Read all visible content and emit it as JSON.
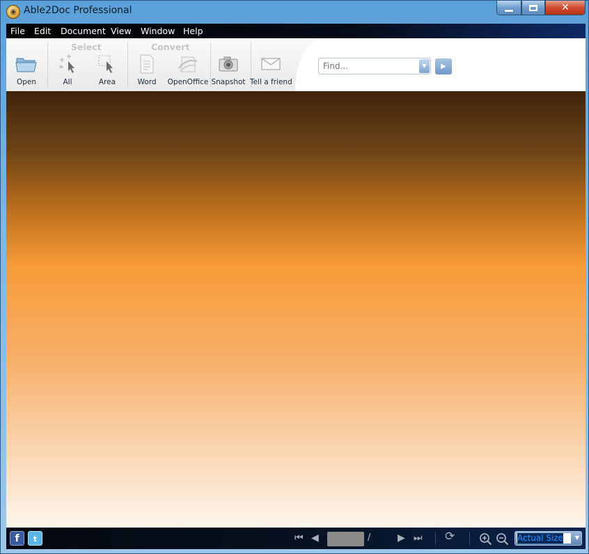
{
  "window": {
    "title": "Able2Doc Professional",
    "icon": "able2doc-logo-icon"
  },
  "menu": [
    "File",
    "Edit",
    "Document",
    "View",
    "Window",
    "Help"
  ],
  "toolbar": {
    "open_label": "Open",
    "select_group": "Select",
    "select_all_label": "All",
    "select_area_label": "Area",
    "convert_group": "Convert",
    "word_label": "Word",
    "openoffice_label": "OpenOffice",
    "snapshot_label": "Snapshot",
    "tell_friend_label": "Tell a friend",
    "find_placeholder": "Find..."
  },
  "statusbar": {
    "page_separator": "/",
    "zoom_value": "Actual Size"
  },
  "colors": {
    "menu_bg": "#000000",
    "canvas_top": "#3f240c",
    "canvas_mid": "#f79b37",
    "canvas_bottom": "#fef6ec",
    "accent": "#6f98c4"
  }
}
